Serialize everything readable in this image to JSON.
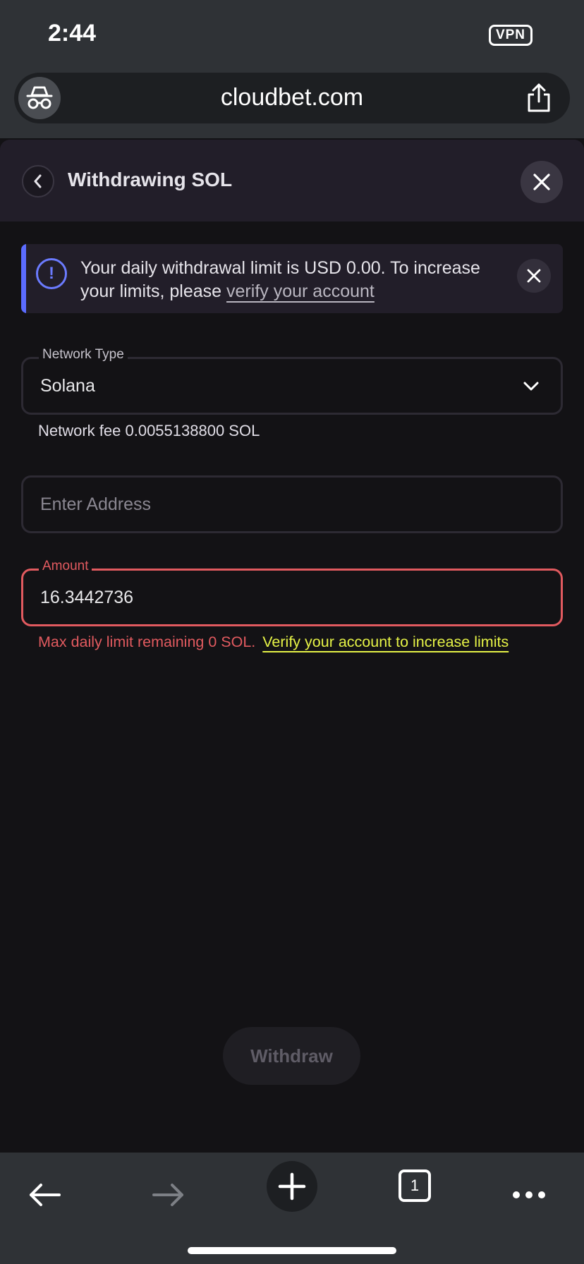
{
  "status_bar": {
    "time": "2:44",
    "vpn": "VPN"
  },
  "browser": {
    "url": "cloudbet.com",
    "tab_count": "1"
  },
  "modal": {
    "title": "Withdrawing SOL"
  },
  "alert": {
    "text": "Your daily withdrawal limit is USD 0.00. To increase your limits, please ",
    "link": "verify your account",
    "accent_color": "#5b6cff"
  },
  "network": {
    "legend": "Network Type",
    "value": "Solana",
    "fee": "Network fee 0.0055138800 SOL"
  },
  "address": {
    "placeholder": "Enter Address"
  },
  "amount": {
    "legend": "Amount",
    "value": "16.3442736",
    "error": "Max daily limit remaining 0 SOL.",
    "verify_link": "Verify your account to increase limits",
    "error_color": "#e15a5f",
    "link_color": "#e5f246"
  },
  "withdraw": {
    "label": "Withdraw",
    "enabled": false
  },
  "icons": {
    "incognito": "incognito-icon",
    "share": "share-icon",
    "back": "chevron-left-icon",
    "close": "close-icon",
    "info": "info-icon",
    "dropdown": "chevron-down-icon",
    "nav_back": "arrow-left-icon",
    "nav_forward": "arrow-right-icon",
    "new_tab": "plus-icon",
    "more": "more-icon"
  }
}
